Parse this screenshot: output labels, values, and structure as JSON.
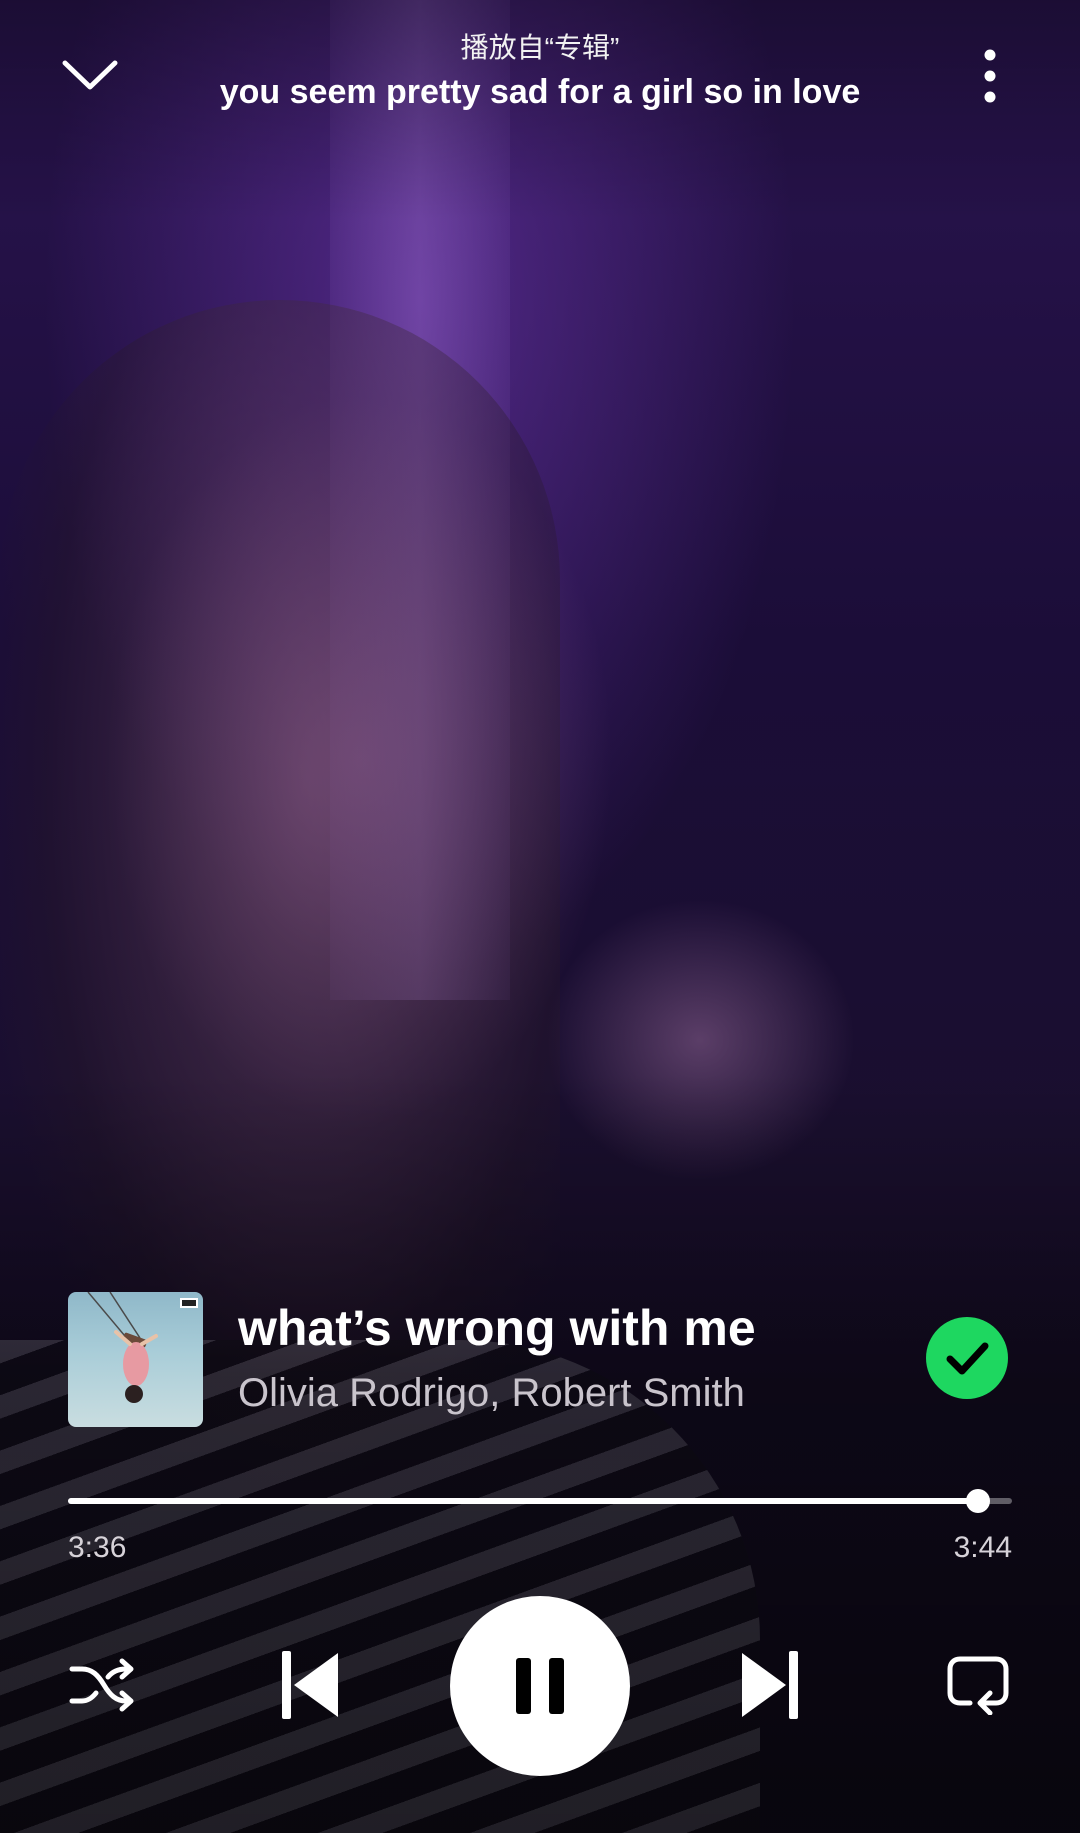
{
  "header": {
    "playing_from": "播放自“专辑”",
    "context_title": "you seem pretty sad for a girl so in love",
    "collapse_icon": "chevron-down-icon",
    "more_icon": "more-vertical-icon"
  },
  "track": {
    "title": "what’s wrong with me",
    "artists": "Olivia Rodrigo, Robert Smith",
    "album_art": "album-art",
    "saved": true,
    "saved_icon": "check-circle-icon"
  },
  "playback": {
    "elapsed": "3:36",
    "total": "3:44",
    "progress_fraction": 0.964,
    "state": "playing"
  },
  "controls": {
    "shuffle_icon": "shuffle-icon",
    "previous_icon": "skip-previous-icon",
    "play_pause_icon": "pause-icon",
    "next_icon": "skip-next-icon",
    "repeat_icon": "repeat-icon"
  },
  "colors": {
    "accent_green": "#1ed760",
    "text_primary": "#ffffff",
    "text_secondary": "#c9c4cc"
  }
}
